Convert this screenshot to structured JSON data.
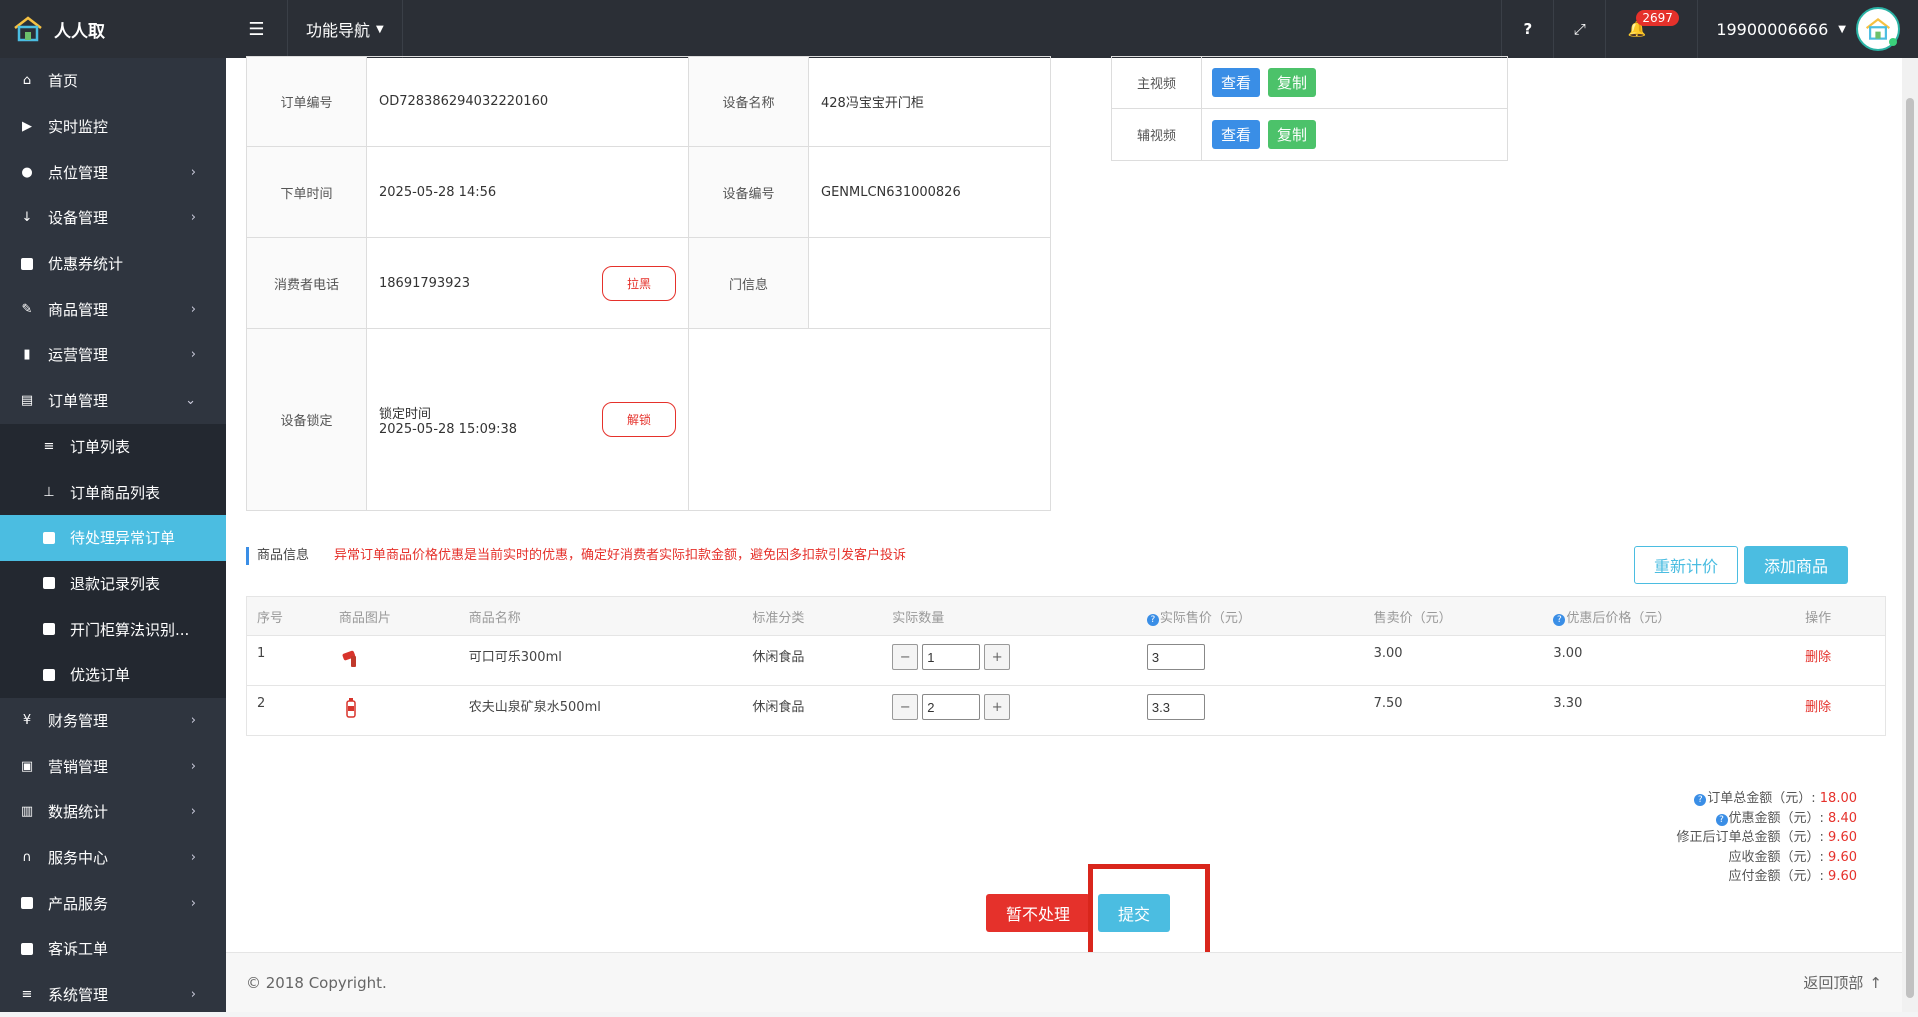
{
  "brand": {
    "name": "人人取"
  },
  "topbar": {
    "func_nav": "功能导航",
    "notif_count": "2697",
    "user_phone": "19900006666"
  },
  "sidebar": {
    "items": [
      {
        "label": "首页",
        "icon": "home-icon",
        "chevron": false
      },
      {
        "label": "实时监控",
        "icon": "video-camera-icon",
        "chevron": false
      },
      {
        "label": "点位管理",
        "icon": "map-marker-icon",
        "chevron": true
      },
      {
        "label": "设备管理",
        "icon": "sort-icon",
        "chevron": true
      },
      {
        "label": "优惠券统计",
        "icon": "square-icon",
        "chevron": false
      },
      {
        "label": "商品管理",
        "icon": "edit-icon",
        "chevron": true
      },
      {
        "label": "运营管理",
        "icon": "bookmark-icon",
        "chevron": true
      },
      {
        "label": "订单管理",
        "icon": "table-icon",
        "chevron": "down"
      },
      {
        "label": "订单列表",
        "icon": "list-icon",
        "sub": true
      },
      {
        "label": "订单商品列表",
        "icon": "sitemap-icon",
        "sub": true
      },
      {
        "label": "待处理异常订单",
        "icon": "square-icon",
        "sub": true,
        "active": true
      },
      {
        "label": "退款记录列表",
        "icon": "square-icon",
        "sub": true
      },
      {
        "label": "开门柜算法识别...",
        "icon": "square-icon",
        "sub": true
      },
      {
        "label": "优选订单",
        "icon": "square-icon",
        "sub": true
      },
      {
        "label": "财务管理",
        "icon": "yen-icon",
        "chevron": true
      },
      {
        "label": "营销管理",
        "icon": "gift-icon",
        "chevron": true
      },
      {
        "label": "数据统计",
        "icon": "bar-chart-icon",
        "chevron": true
      },
      {
        "label": "服务中心",
        "icon": "headset-icon",
        "chevron": true
      },
      {
        "label": "产品服务",
        "icon": "square-icon",
        "chevron": true
      },
      {
        "label": "客诉工单",
        "icon": "square-icon",
        "chevron": false
      },
      {
        "label": "系统管理",
        "icon": "list-icon",
        "chevron": true
      }
    ]
  },
  "order_info": {
    "order_no_label": "订单编号",
    "order_no": "OD728386294032220160",
    "device_name_label": "设备名称",
    "device_name": "428冯宝宝开门柜",
    "order_time_label": "下单时间",
    "order_time": "2025-05-28 14:56",
    "device_no_label": "设备编号",
    "device_no": "GENMLCN631000826",
    "phone_label": "消费者电话",
    "phone": "18691793923",
    "blacklist_btn": "拉黑",
    "door_info_label": "门信息",
    "door_info": "",
    "lock_label": "设备锁定",
    "lock_time_label": "锁定时间",
    "lock_time": "2025-05-28 15:09:38",
    "unlock_btn": "解锁"
  },
  "video": {
    "main_label": "主视频",
    "aux_label": "辅视频",
    "view_btn": "查看",
    "copy_btn": "复制"
  },
  "goods": {
    "section_title": "商品信息",
    "warning": "异常订单商品价格优惠是当前实时的优惠，确定好消费者实际扣款金额，避免因多扣款引发客户投诉",
    "recalc_btn": "重新计价",
    "add_btn": "添加商品",
    "headers": [
      "序号",
      "商品图片",
      "商品名称",
      "标准分类",
      "实际数量",
      "实际售价（元）",
      "售卖价（元）",
      "优惠后价格（元）",
      "操作"
    ],
    "rows": [
      {
        "no": "1",
        "name": "可口可乐300ml",
        "category": "休闲食品",
        "qty": "1",
        "price": "3",
        "sale_price": "3.00",
        "discount_price": "3.00",
        "action": "删除"
      },
      {
        "no": "2",
        "name": "农夫山泉矿泉水500ml",
        "category": "休闲食品",
        "qty": "2",
        "price": "3.3",
        "sale_price": "7.50",
        "discount_price": "3.30",
        "action": "删除"
      }
    ]
  },
  "summary": {
    "total_label": "订单总金额（元）:",
    "total": "18.00",
    "discount_label": "优惠金额（元）:",
    "discount": "8.40",
    "revised_label": "修正后订单总金额（元）:",
    "revised": "9.60",
    "receivable_label": "应收金额（元）:",
    "receivable": "9.60",
    "payable_label": "应付金额（元）:",
    "payable": "9.60"
  },
  "actions": {
    "hold_btn": "暂不处理",
    "submit_btn": "提交"
  },
  "footer": {
    "copyright": "© 2018 Copyright.",
    "back_top": "返回顶部"
  },
  "colors": {
    "accent": "#4bbde1",
    "danger": "#e5312b",
    "sidebar": "#2f353f",
    "topbar": "#2b2f36"
  }
}
